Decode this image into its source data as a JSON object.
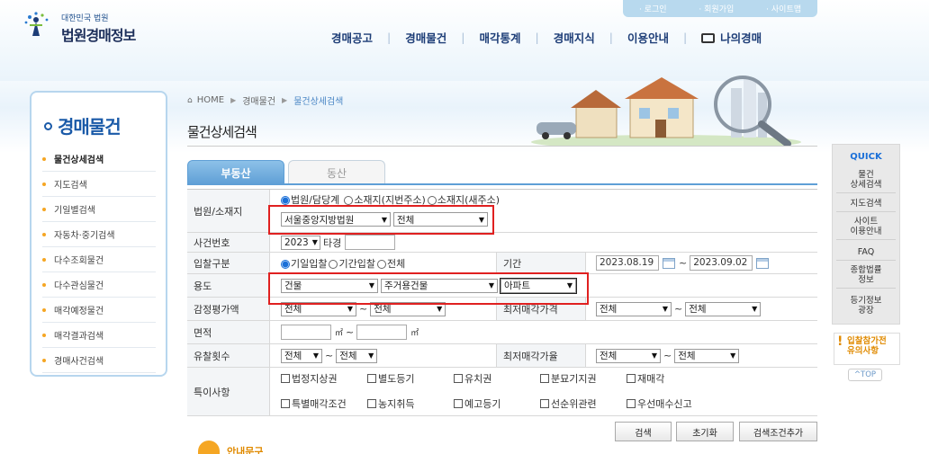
{
  "header": {
    "util": [
      "· 로그인",
      "· 회원가입",
      "· 사이트맵"
    ],
    "logo_small": "대한민국 법원",
    "logo_big": "법원경매정보",
    "gnb": [
      "경매공고",
      "경매물건",
      "매각통계",
      "경매지식",
      "이용안내",
      "나의경매"
    ]
  },
  "sidebar": {
    "title": "경매물건",
    "items": [
      {
        "label": "물건상세검색",
        "active": true
      },
      {
        "label": "지도검색"
      },
      {
        "label": "기일별검색"
      },
      {
        "label": "자동차·중기검색"
      },
      {
        "label": "다수조회물건"
      },
      {
        "label": "다수관심물건"
      },
      {
        "label": "매각예정물건"
      },
      {
        "label": "매각결과검색"
      },
      {
        "label": "경매사건검색"
      }
    ]
  },
  "breadcrumb": {
    "home": "HOME",
    "level1": "경매물건",
    "current": "물건상세검색"
  },
  "page_title": "물건상세검색",
  "tabs": {
    "real_estate": "부동산",
    "movable": "동산"
  },
  "form": {
    "court": {
      "label": "법원/소재지",
      "radio1": "법원/담당계",
      "radio2": "소재지(지번주소)",
      "radio3": "소재지(새주소)",
      "court_select": "서울중앙지방법원",
      "dept_select": "전체"
    },
    "case": {
      "label": "사건번호",
      "year": "2023",
      "suffix": "타경"
    },
    "bid": {
      "label": "입찰구분",
      "radio1": "기일입찰",
      "radio2": "기간입찰",
      "radio3": "전체",
      "period_label": "기간",
      "date_from": "2023.08.19",
      "date_to": "2023.09.02"
    },
    "usage": {
      "label": "용도",
      "sel1": "건물",
      "sel2": "주거용건물",
      "sel3": "아파트"
    },
    "appraisal": {
      "label": "감정평가액",
      "from": "전체",
      "to": "전체",
      "min_price_label": "최저매각가격",
      "min_from": "전체",
      "min_to": "전체"
    },
    "area": {
      "label": "면적",
      "unit": "㎡"
    },
    "fail": {
      "label": "유찰횟수",
      "from": "전체",
      "to": "전체",
      "rate_label": "최저매각가율",
      "rate_from": "전체",
      "rate_to": "전체"
    },
    "special": {
      "label": "특이사항",
      "items": [
        "법정지상권",
        "별도등기",
        "유치권",
        "분묘기지권",
        "재매각",
        "특별매각조건",
        "농지취득",
        "예고등기",
        "선순위관련",
        "우선매수신고"
      ]
    },
    "tilde": "~"
  },
  "buttons": {
    "search": "검색",
    "reset": "초기화",
    "add": "검색조건추가"
  },
  "quick": {
    "title": "QUICK",
    "items": [
      "물건\n상세검색",
      "지도검색",
      "사이트\n이용안내",
      "FAQ",
      "종합법률\n정보",
      "등기정보\n광장"
    ],
    "banner": "입찰참가전\n유의사항",
    "top": "^TOP"
  },
  "help_text": "안내문구"
}
